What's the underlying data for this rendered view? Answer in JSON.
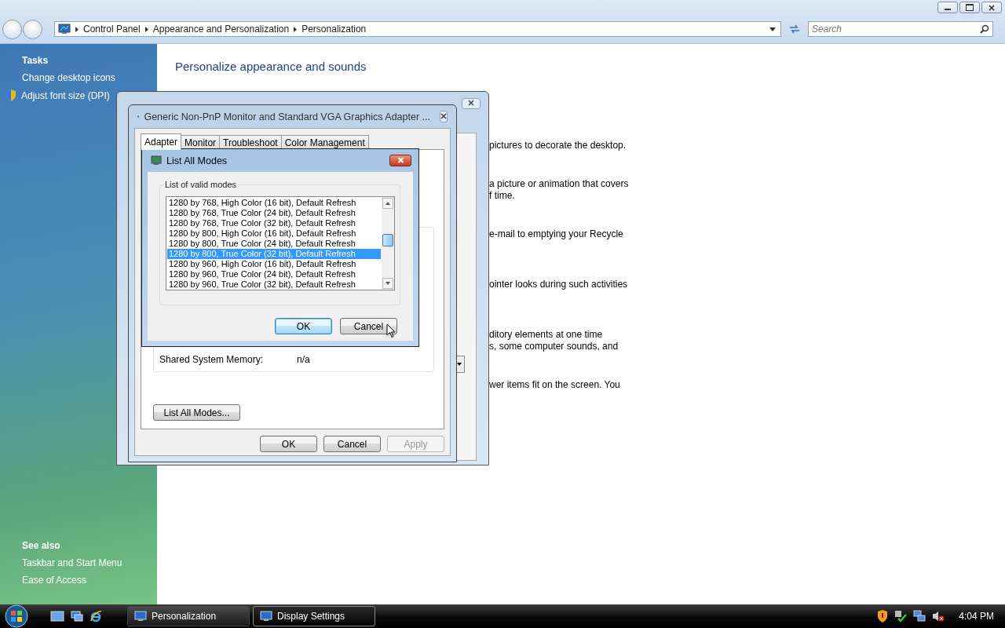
{
  "explorer": {
    "breadcrumb": [
      "Control Panel",
      "Appearance and Personalization",
      "Personalization"
    ],
    "search": {
      "placeholder": "Search"
    }
  },
  "sidebar": {
    "tasks_title": "Tasks",
    "tasks": [
      {
        "label": "Change desktop icons",
        "kind": "link"
      },
      {
        "label": "Adjust font size (DPI)",
        "kind": "shield"
      }
    ],
    "see_also_title": "See also",
    "see_also": [
      "Taskbar and Start Menu",
      "Ease of Access"
    ]
  },
  "content": {
    "heading": "Personalize appearance and sounds",
    "blocks": [
      [
        "pictures to decorate the desktop."
      ],
      [
        "a picture or animation that covers",
        "f time."
      ],
      [
        "e-mail to emptying your Recycle"
      ],
      [
        "ointer looks during such activities"
      ],
      [
        "ditory elements at one time",
        "s, some computer sounds, and"
      ],
      [
        "wer items fit on the screen. You"
      ]
    ]
  },
  "properties_dialog": {
    "title": "Generic Non-PnP Monitor and Standard VGA Graphics Adapter ...",
    "tabs": [
      {
        "label": "Adapter",
        "selected": true
      },
      {
        "label": "Monitor",
        "selected": false
      },
      {
        "label": "Troubleshoot",
        "selected": false
      },
      {
        "label": "Color Management",
        "selected": false
      }
    ],
    "memory_label": "Shared System Memory:",
    "memory_value": "n/a",
    "list_modes_button": "List All Modes...",
    "buttons": [
      {
        "label": "OK",
        "disabled": false
      },
      {
        "label": "Cancel",
        "disabled": false
      },
      {
        "label": "Apply",
        "disabled": true
      }
    ]
  },
  "modes_dialog": {
    "title": "List All Modes",
    "group_label": "List of valid modes",
    "modes": [
      {
        "label": "1280 by 768, High Color (16 bit), Default Refresh",
        "selected": false
      },
      {
        "label": "1280 by 768, True Color (24 bit), Default Refresh",
        "selected": false
      },
      {
        "label": "1280 by 768, True Color (32 bit), Default Refresh",
        "selected": false
      },
      {
        "label": "1280 by 800, High Color (16 bit), Default Refresh",
        "selected": false
      },
      {
        "label": "1280 by 800, True Color (24 bit), Default Refresh",
        "selected": false
      },
      {
        "label": "1280 by 800, True Color (32 bit), Default Refresh",
        "selected": true
      },
      {
        "label": "1280 by 960, High Color (16 bit), Default Refresh",
        "selected": false
      },
      {
        "label": "1280 by 960, True Color (24 bit), Default Refresh",
        "selected": false
      },
      {
        "label": "1280 by 960, True Color (32 bit), Default Refresh",
        "selected": false
      }
    ],
    "buttons": [
      {
        "label": "OK",
        "default": true
      },
      {
        "label": "Cancel",
        "default": false
      }
    ]
  },
  "taskbar": {
    "tasks": [
      {
        "label": "Personalization",
        "selected": false
      },
      {
        "label": "Display Settings",
        "selected": true
      }
    ],
    "clock": "4:04 PM"
  }
}
